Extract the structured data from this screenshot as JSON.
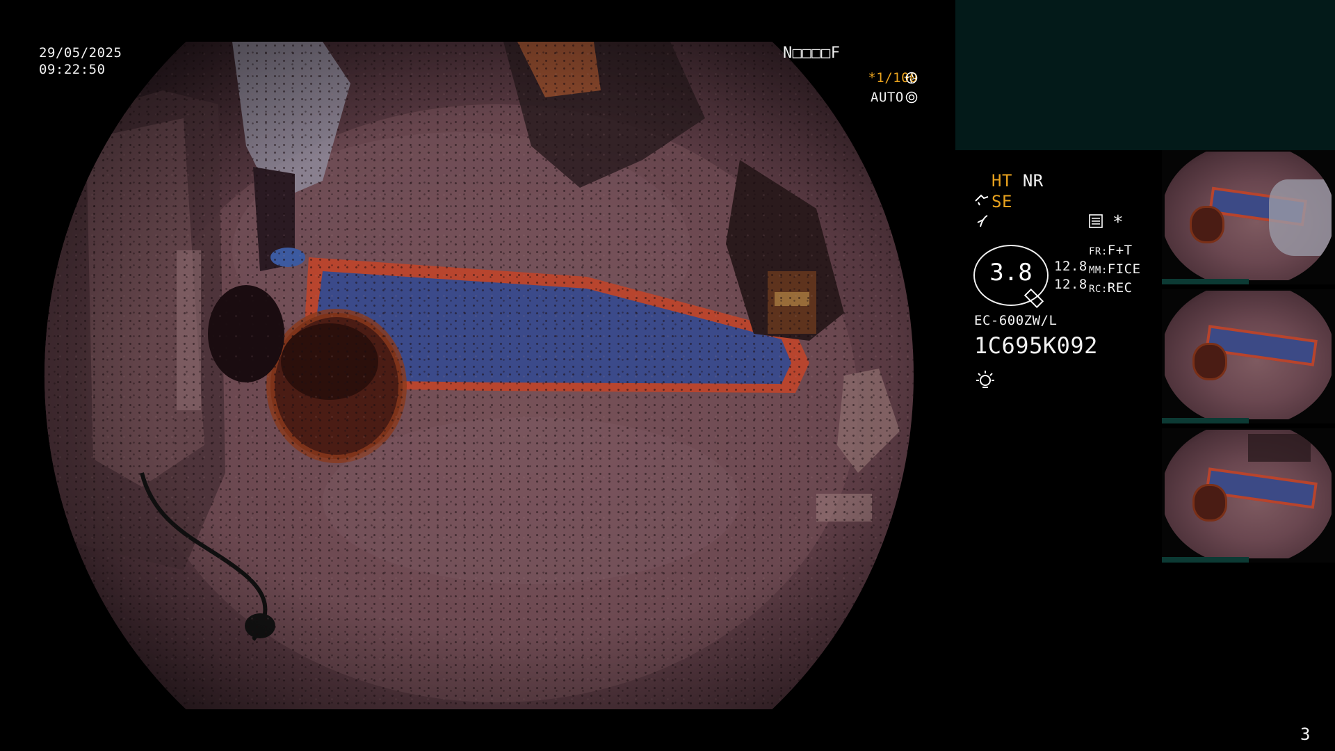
{
  "osd": {
    "date": "29/05/2025",
    "time": "09:22:50",
    "patient_id": "N□□□□F",
    "shutter": "*1/100",
    "shutter_icon": "aperture-icon",
    "iris": "AUTO",
    "iris_icon": "iris-icon",
    "page_number": "3"
  },
  "settings": {
    "ht": "HT",
    "nr": "NR",
    "se": "SE",
    "se_icon": "pump-icon",
    "flow_icon": "flow-icon",
    "menu_icon": "menu-icon",
    "asterisk": "*",
    "gauge_value": "3.8",
    "gauge_left_values": [
      "12.8",
      "12.8"
    ],
    "fr_label": "FR:",
    "fr_value": "F+T",
    "mm_label": "MM:",
    "mm_value": "FICE",
    "rc_label": "RC:",
    "rc_value": "REC",
    "scope_model": "EC-600ZW/L",
    "scope_serial": "1C695K092",
    "light_icon": "light-icon"
  },
  "colors": {
    "accent_yellow": "#e8a21e",
    "panel_teal": "#031a19",
    "thumb_bar": "#0c3a34"
  },
  "thumbnails": [
    {
      "label": "thumbnail-1"
    },
    {
      "label": "thumbnail-2"
    },
    {
      "label": "thumbnail-3"
    }
  ]
}
